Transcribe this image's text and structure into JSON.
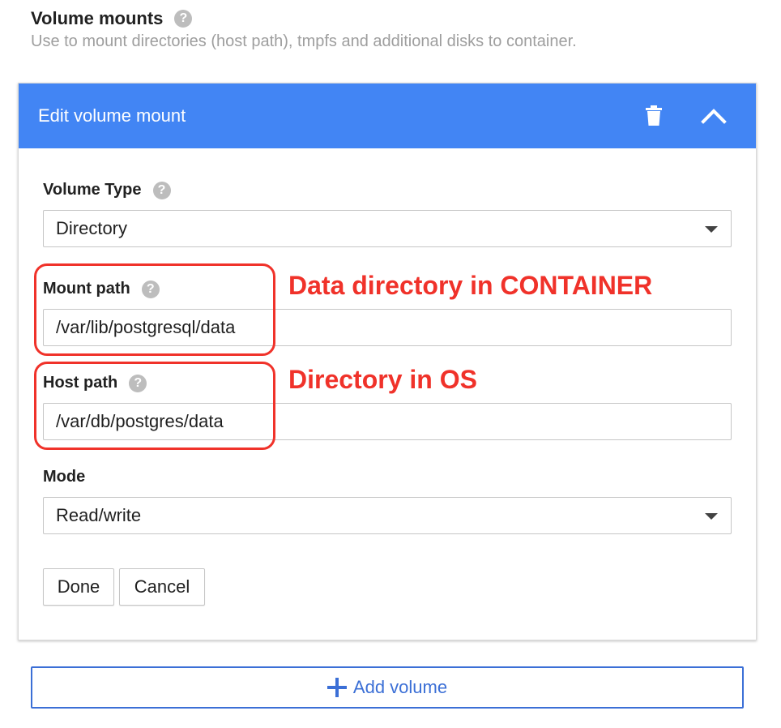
{
  "section": {
    "title": "Volume mounts",
    "description": "Use to mount directories (host path), tmpfs and additional disks to container.",
    "help_icon": "help-icon"
  },
  "card": {
    "title": "Edit volume mount",
    "header_color": "#4285f4",
    "icons": {
      "delete": "trash-icon",
      "collapse": "chevron-up-icon"
    }
  },
  "form": {
    "volume_type": {
      "label": "Volume Type",
      "value": "Directory"
    },
    "mount_path": {
      "label": "Mount path",
      "value": "/var/lib/postgresql/data"
    },
    "host_path": {
      "label": "Host path",
      "value": "/var/db/postgres/data"
    },
    "mode": {
      "label": "Mode",
      "value": "Read/write"
    }
  },
  "buttons": {
    "done": "Done",
    "cancel": "Cancel",
    "add_volume": "Add volume"
  },
  "annotations": {
    "color": "#f0322a",
    "mount_note": "Data directory in CONTAINER",
    "host_note": "Directory in OS"
  },
  "accent_color": "#3b6fd6"
}
